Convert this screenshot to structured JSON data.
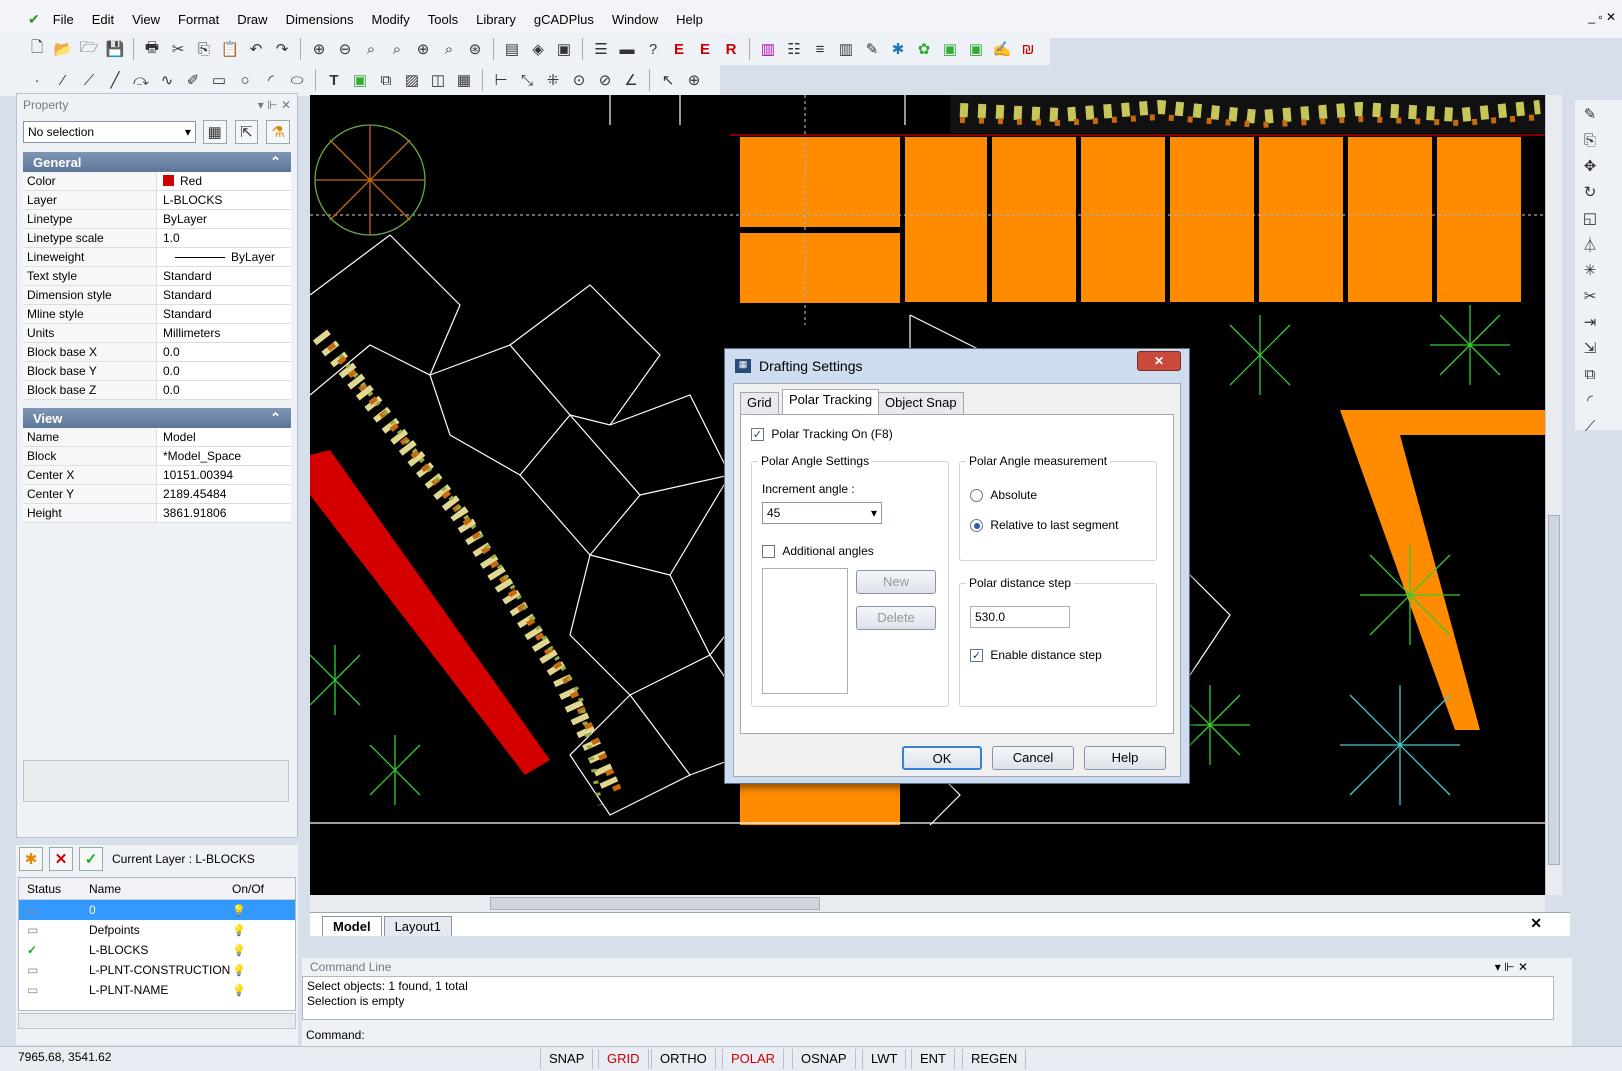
{
  "menu": [
    "File",
    "Edit",
    "View",
    "Format",
    "Draw",
    "Dimensions",
    "Modify",
    "Tools",
    "Library",
    "gCADPlus",
    "Window",
    "Help"
  ],
  "window_controls": "_ ▫ ✕",
  "property": {
    "title": "Property",
    "controls": "▾ ⊩ ✕",
    "selection": "No selection",
    "general": {
      "header": "General",
      "rows": [
        [
          "Color",
          "Red"
        ],
        [
          "Layer",
          "L-BLOCKS"
        ],
        [
          "Linetype",
          "ByLayer"
        ],
        [
          "Linetype scale",
          "1.0"
        ],
        [
          "Lineweight",
          "ByLayer"
        ],
        [
          "Text style",
          "Standard"
        ],
        [
          "Dimension style",
          "Standard"
        ],
        [
          "Mline style",
          "Standard"
        ],
        [
          "Units",
          "Millimeters"
        ],
        [
          "Block base X",
          "0.0"
        ],
        [
          "Block base Y",
          "0.0"
        ],
        [
          "Block base Z",
          "0.0"
        ]
      ]
    },
    "view": {
      "header": "View",
      "rows": [
        [
          "Name",
          "Model"
        ],
        [
          "Block",
          "*Model_Space"
        ],
        [
          "Center X",
          "10151.00394"
        ],
        [
          "Center Y",
          "2189.45484"
        ],
        [
          "Height",
          "3861.91806"
        ]
      ]
    }
  },
  "layers": {
    "current": "Current Layer : L-BLOCKS",
    "headers": [
      "Status",
      "Name",
      "On/Of"
    ],
    "rows": [
      {
        "name": "0",
        "status": "▭"
      },
      {
        "name": "Defpoints",
        "status": "▭"
      },
      {
        "name": "L-BLOCKS",
        "status": "✓"
      },
      {
        "name": "L-PLNT-CONSTRUCTION",
        "status": "▭"
      },
      {
        "name": "L-PLNT-NAME",
        "status": "▭"
      }
    ]
  },
  "tabs": [
    "Model",
    "Layout1"
  ],
  "command": {
    "title": "Command Line",
    "lines": [
      "Select objects: 1 found,  1 total",
      "Selection is empty"
    ],
    "prompt": "Command:"
  },
  "status": {
    "coords": "7965.68, 3541.62",
    "toggles": [
      "SNAP",
      "GRID",
      "ORTHO",
      "POLAR",
      "OSNAP",
      "LWT",
      "ENT",
      "REGEN"
    ]
  },
  "dialog": {
    "title": "Drafting Settings",
    "tabs": [
      "Grid",
      "Polar Tracking",
      "Object Snap"
    ],
    "polar_on": "Polar Tracking On (F8)",
    "angle_settings": "Polar Angle Settings",
    "increment_label": "Increment angle :",
    "increment_value": "45",
    "additional": "Additional angles",
    "new": "New",
    "delete": "Delete",
    "measurement": "Polar Angle measurement",
    "absolute": "Absolute",
    "relative": "Relative to last segment",
    "distance_step": "Polar distance step",
    "distance_value": "530.0",
    "enable_distance": "Enable distance step",
    "ok": "OK",
    "cancel": "Cancel",
    "help": "Help"
  },
  "colors": {
    "accent_orange": "#ff8c00",
    "red": "#d40000",
    "canvas": "#000000"
  }
}
